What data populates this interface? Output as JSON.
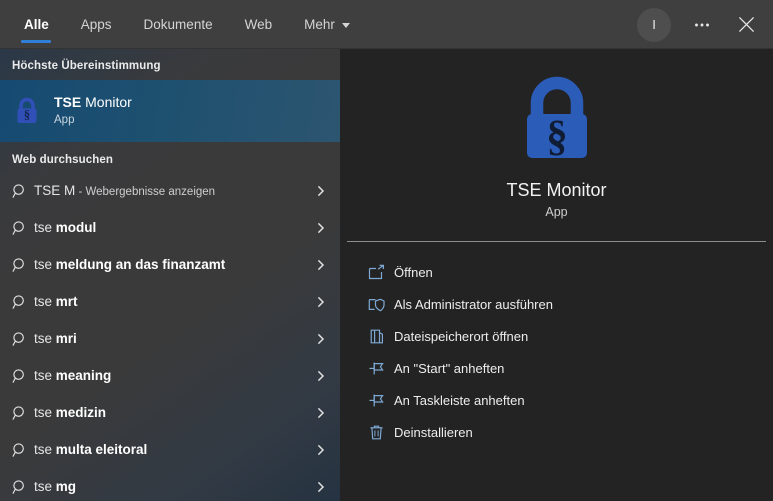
{
  "accent_color": "#2f7fd6",
  "icon_color": "#2b5cb8",
  "action_icon_color": "#7ea9d4",
  "header": {
    "tabs": [
      {
        "label": "Alle",
        "active": true,
        "has_chevron": false,
        "name": "tab-alle"
      },
      {
        "label": "Apps",
        "active": false,
        "has_chevron": false,
        "name": "tab-apps"
      },
      {
        "label": "Dokumente",
        "active": false,
        "has_chevron": false,
        "name": "tab-dokumente"
      },
      {
        "label": "Web",
        "active": false,
        "has_chevron": false,
        "name": "tab-web"
      },
      {
        "label": "Mehr",
        "active": false,
        "has_chevron": true,
        "name": "tab-mehr"
      }
    ],
    "avatar_initial": "I",
    "avatar_icon": "account-avatar",
    "more_options_icon": "ellipsis-icon",
    "close_icon": "close-icon"
  },
  "left_panel": {
    "best_match_label": "Höchste Übereinstimmung",
    "best_match": {
      "title_bold": "TSE",
      "title_rest": " Monitor",
      "subtitle": "App",
      "icon": "lock-section-icon"
    },
    "web_search_label": "Web durchsuchen",
    "suggestions": [
      {
        "lite": "TSE M",
        "bold": "",
        "tail": " - Webergebnisse anzeigen",
        "icon": "search-icon",
        "chevron": "chevron-right-icon"
      },
      {
        "lite": "tse ",
        "bold": "modul",
        "tail": "",
        "icon": "search-icon",
        "chevron": "chevron-right-icon"
      },
      {
        "lite": "tse ",
        "bold": "meldung an das finanzamt",
        "tail": "",
        "icon": "search-icon",
        "chevron": "chevron-right-icon"
      },
      {
        "lite": "tse ",
        "bold": "mrt",
        "tail": "",
        "icon": "search-icon",
        "chevron": "chevron-right-icon"
      },
      {
        "lite": "tse ",
        "bold": "mri",
        "tail": "",
        "icon": "search-icon",
        "chevron": "chevron-right-icon"
      },
      {
        "lite": "tse ",
        "bold": "meaning",
        "tail": "",
        "icon": "search-icon",
        "chevron": "chevron-right-icon"
      },
      {
        "lite": "tse ",
        "bold": "medizin",
        "tail": "",
        "icon": "search-icon",
        "chevron": "chevron-right-icon"
      },
      {
        "lite": "tse ",
        "bold": "multa eleitoral",
        "tail": "",
        "icon": "search-icon",
        "chevron": "chevron-right-icon"
      },
      {
        "lite": "tse ",
        "bold": "mg",
        "tail": "",
        "icon": "search-icon",
        "chevron": "chevron-right-icon"
      }
    ]
  },
  "right_panel": {
    "app_icon": "lock-section-icon",
    "app_name": "TSE Monitor",
    "app_kind": "App",
    "actions": [
      {
        "label": "Öffnen",
        "icon": "open-external-icon"
      },
      {
        "label": "Als Administrator ausführen",
        "icon": "shield-admin-icon"
      },
      {
        "label": "Dateispeicherort öffnen",
        "icon": "folder-open-icon"
      },
      {
        "label": "An \"Start\" anheften",
        "icon": "pin-icon"
      },
      {
        "label": "An Taskleiste anheften",
        "icon": "pin-icon"
      },
      {
        "label": "Deinstallieren",
        "icon": "trash-icon"
      }
    ]
  }
}
